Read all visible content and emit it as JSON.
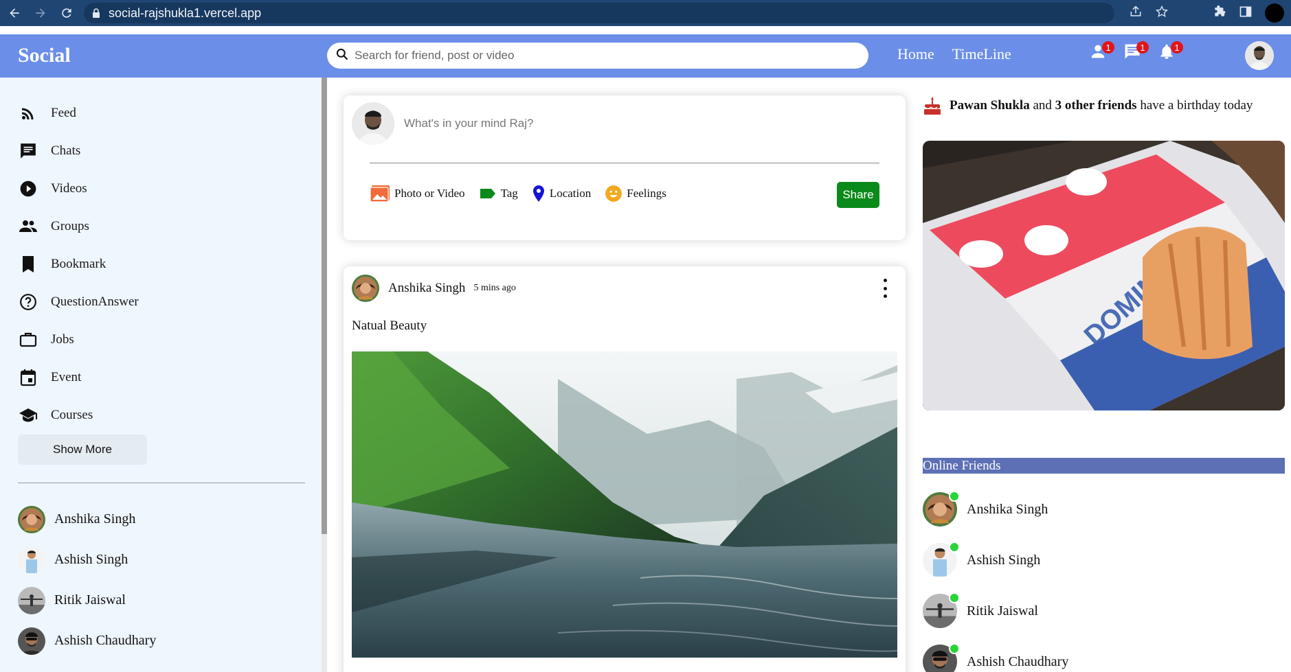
{
  "browser": {
    "url": "social-rajshukla1.vercel.app"
  },
  "topbar": {
    "logo": "Social",
    "search_placeholder": "Search for friend, post or video",
    "links": [
      "Home",
      "TimeLine"
    ],
    "badges": {
      "friend_requests": "1",
      "messages": "1",
      "notifications": "1"
    }
  },
  "sidebar": {
    "items": [
      {
        "label": "Feed",
        "icon": "rss-icon"
      },
      {
        "label": "Chats",
        "icon": "chat-icon"
      },
      {
        "label": "Videos",
        "icon": "play-circle-icon"
      },
      {
        "label": "Groups",
        "icon": "group-icon"
      },
      {
        "label": "Bookmark",
        "icon": "bookmark-icon"
      },
      {
        "label": "QuestionAnswer",
        "icon": "help-circle-icon"
      },
      {
        "label": "Jobs",
        "icon": "briefcase-icon"
      },
      {
        "label": "Event",
        "icon": "calendar-icon"
      },
      {
        "label": "Courses",
        "icon": "school-icon"
      }
    ],
    "show_more": "Show More",
    "friends": [
      "Anshika Singh",
      "Ashish Singh",
      "Ritik Jaiswal",
      "Ashish Chaudhary"
    ]
  },
  "share": {
    "placeholder": "What's in your mind Raj?",
    "options": [
      "Photo or Video",
      "Tag",
      "Location",
      "Feelings"
    ],
    "button": "Share"
  },
  "post": {
    "author": "Anshika Singh",
    "time": "5 mins ago",
    "text": "Natual Beauty"
  },
  "rightbar": {
    "birthday_name": "Pawan Shukla",
    "birthday_and": " and ",
    "birthday_others": "3 other friends",
    "birthday_tail": " have a birthday today",
    "online_title": "Online Friends",
    "online_friends": [
      "Anshika Singh",
      "Ashish Singh",
      "Ritik Jaiswal",
      "Ashish Chaudhary"
    ]
  },
  "colors": {
    "topbar": "#6b8ee8",
    "sidebar_bg": "#eef6fe",
    "share_button": "#0a8a1a",
    "badge": "#e0161b",
    "online_title_bg": "#5d70b5",
    "online_dot": "#29d437"
  }
}
